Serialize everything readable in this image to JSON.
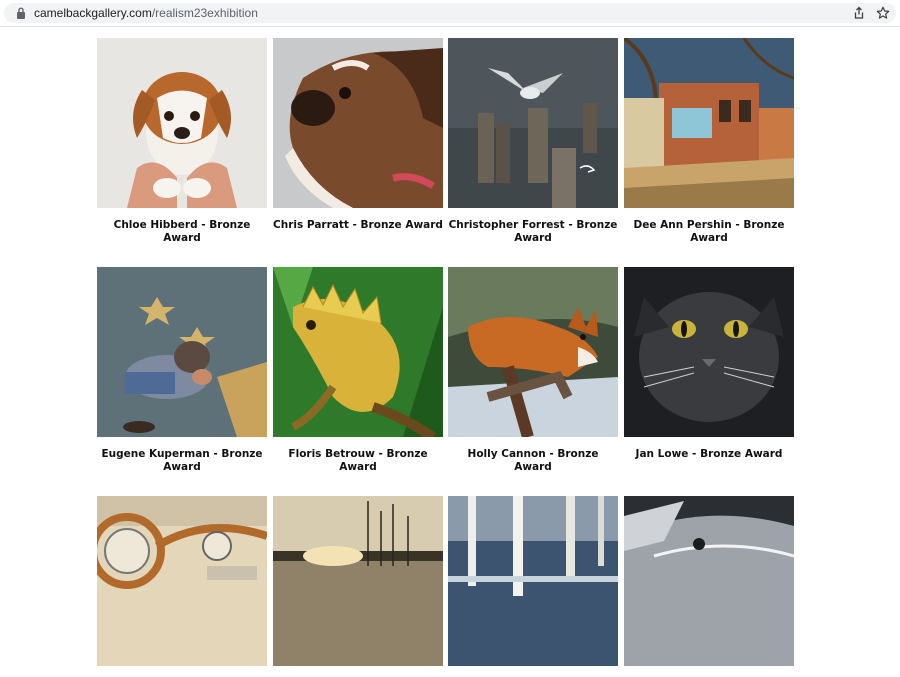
{
  "browser": {
    "url_domain": "camelbackgallery.com",
    "url_path": "/realism23exhibition",
    "share_icon": "share-icon",
    "bookmark_icon": "star-icon"
  },
  "gallery": {
    "items": [
      {
        "caption": "Chloe Hibberd - Bronze Award",
        "image": "puppy-held-in-hands"
      },
      {
        "caption": "Chris Parratt - Bronze Award",
        "image": "boxer-dog-profile"
      },
      {
        "caption": "Christopher Forrest - Bronze Award",
        "image": "seagull-on-pilings"
      },
      {
        "caption": "Dee Ann Pershin - Bronze Award",
        "image": "brick-storefront-street"
      },
      {
        "caption": "Eugene Kuperman - Bronze Award",
        "image": "man-sleeping-walk-of-fame"
      },
      {
        "caption": "Floris Betrouw - Bronze Award",
        "image": "green-iguana"
      },
      {
        "caption": "Holly Cannon - Bronze Award",
        "image": "red-fox-on-log"
      },
      {
        "caption": "Jan Lowe - Bronze Award",
        "image": "black-cat-face"
      },
      {
        "caption": "",
        "image": "vintage-car-dashboard"
      },
      {
        "caption": "",
        "image": "sailboats-sunset"
      },
      {
        "caption": "",
        "image": "birch-trees-river"
      },
      {
        "caption": "",
        "image": "silver-car-hood"
      }
    ]
  }
}
